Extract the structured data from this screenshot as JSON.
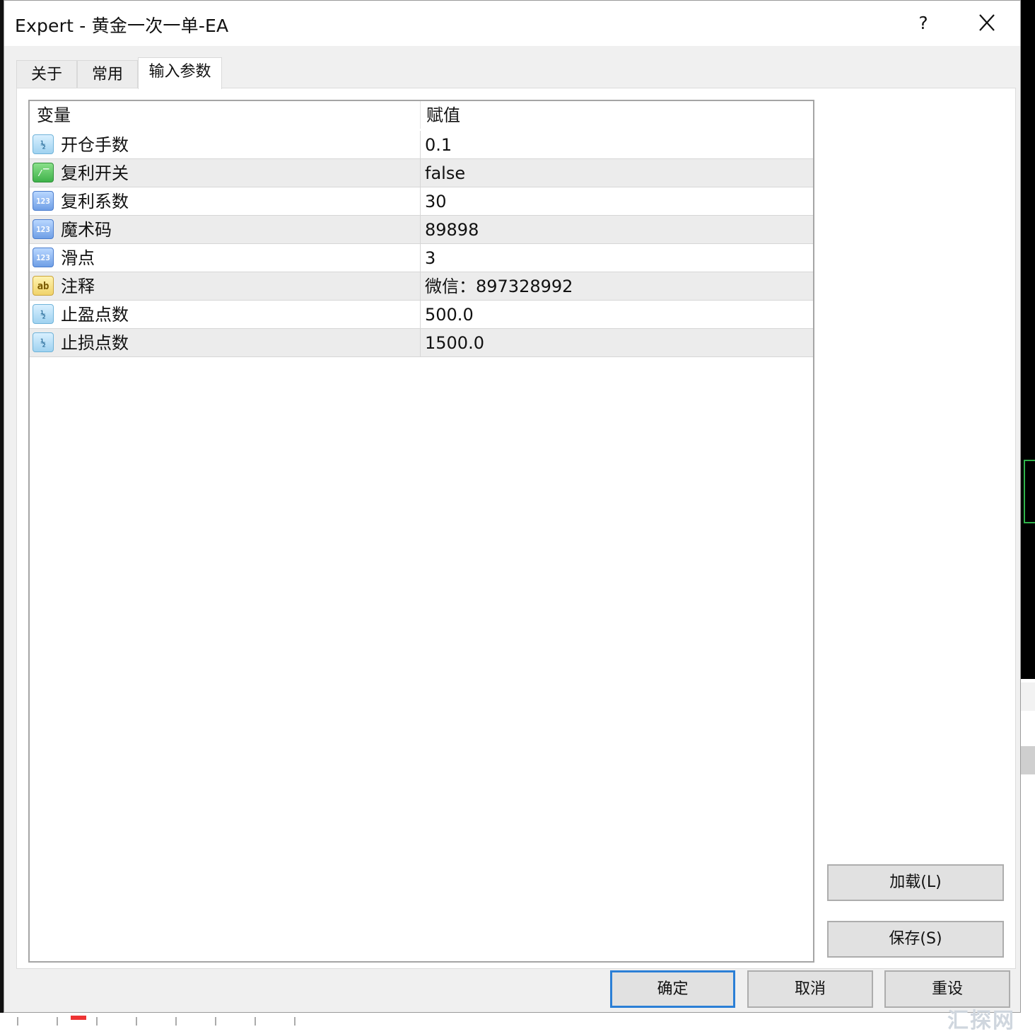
{
  "dialog": {
    "title": "Expert - 黄金一次一单-EA",
    "help_label": "?",
    "close_icon": "close-icon"
  },
  "tabs": [
    {
      "label": "关于",
      "active": false
    },
    {
      "label": "常用",
      "active": false
    },
    {
      "label": "输入参数",
      "active": true
    }
  ],
  "grid": {
    "headers": {
      "variable": "变量",
      "value": "赋值"
    },
    "rows": [
      {
        "icon": "double-value-icon",
        "name": "开仓手数",
        "value": "0.1"
      },
      {
        "icon": "bool-value-icon",
        "name": "复利开关",
        "value": "false"
      },
      {
        "icon": "integer-value-icon",
        "name": "复利系数",
        "value": "30"
      },
      {
        "icon": "integer-value-icon",
        "name": "魔术码",
        "value": "89898"
      },
      {
        "icon": "integer-value-icon",
        "name": "滑点",
        "value": "3"
      },
      {
        "icon": "string-value-icon",
        "name": "注释",
        "value": "微信：897328992"
      },
      {
        "icon": "double-value-icon",
        "name": "止盈点数",
        "value": "500.0"
      },
      {
        "icon": "double-value-icon",
        "name": "止损点数",
        "value": "1500.0"
      }
    ]
  },
  "side_buttons": {
    "load": "加载(L)",
    "save": "保存(S)"
  },
  "footer_buttons": {
    "ok": "确定",
    "cancel": "取消",
    "reset": "重设"
  },
  "watermark": "汇探网",
  "colors": {
    "accent": "#2b7fd6",
    "alt_row": "#ececec",
    "dialog_bg": "#f0f0f0"
  }
}
